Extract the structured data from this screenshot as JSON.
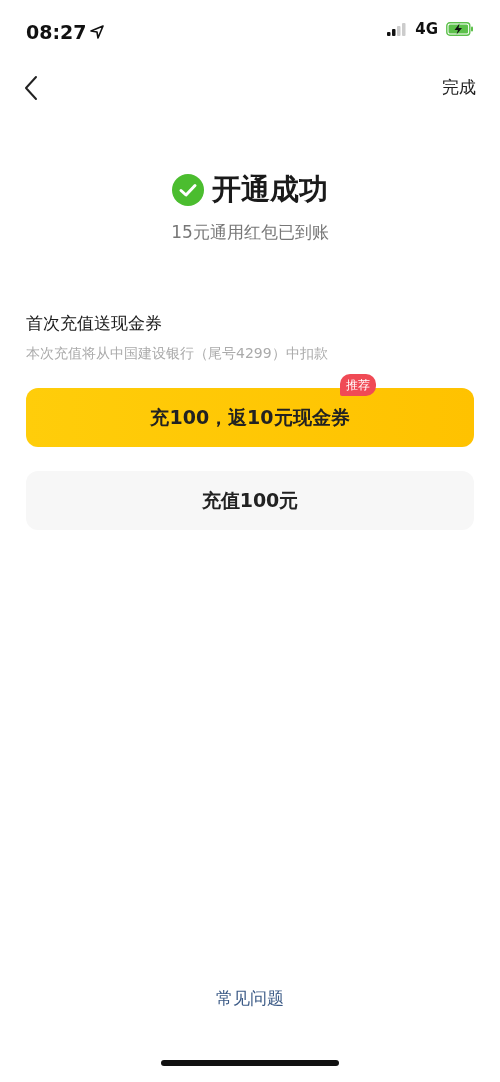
{
  "status_bar": {
    "time": "08:27",
    "network": "4G"
  },
  "nav": {
    "action": "完成"
  },
  "result": {
    "title": "开通成功",
    "subtitle": "15元通用红包已到账"
  },
  "offer": {
    "title": "首次充值送现金券",
    "note": "本次充值将从中国建设银行（尾号4299）中扣款"
  },
  "options": [
    {
      "kind": "primary",
      "label": "充100，返10元现金券",
      "badge": "推荐"
    },
    {
      "kind": "plain",
      "label": "充值100元"
    }
  ],
  "footer_link": "常见问题"
}
